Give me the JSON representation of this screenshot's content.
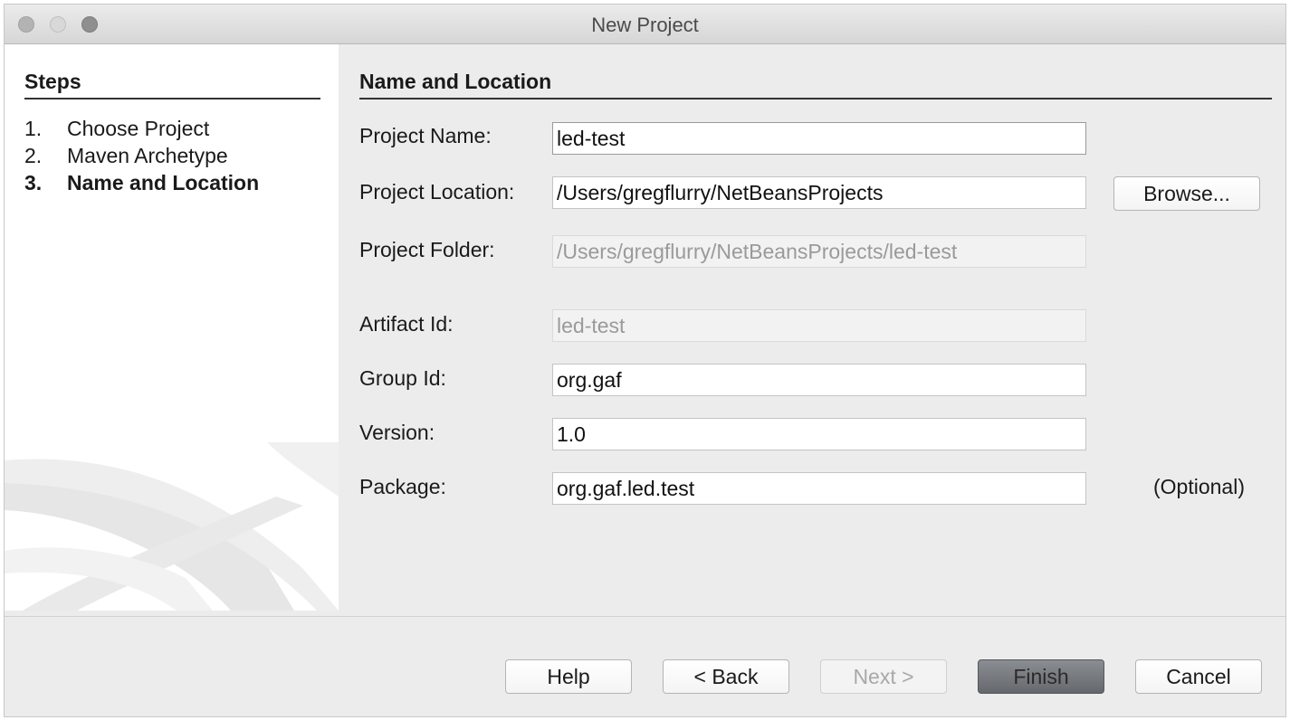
{
  "window": {
    "title": "New Project"
  },
  "steps": {
    "heading": "Steps",
    "items": [
      {
        "number": "1.",
        "label": "Choose Project"
      },
      {
        "number": "2.",
        "label": "Maven Archetype"
      },
      {
        "number": "3.",
        "label": "Name and Location"
      }
    ],
    "current_index": 2
  },
  "form": {
    "heading": "Name and Location",
    "project_name": {
      "label": "Project Name:",
      "value": "led-test"
    },
    "project_location": {
      "label": "Project Location:",
      "value": "/Users/gregflurry/NetBeansProjects"
    },
    "browse_label": "Browse...",
    "project_folder": {
      "label": "Project Folder:",
      "value": "/Users/gregflurry/NetBeansProjects/led-test"
    },
    "artifact_id": {
      "label": "Artifact Id:",
      "value": "led-test"
    },
    "group_id": {
      "label": "Group Id:",
      "value": "org.gaf"
    },
    "version": {
      "label": "Version:",
      "value": "1.0"
    },
    "package": {
      "label": "Package:",
      "value": "org.gaf.led.test",
      "note": "(Optional)"
    }
  },
  "footer": {
    "help_label": "Help",
    "back_label": "< Back",
    "next_label": "Next >",
    "finish_label": "Finish",
    "cancel_label": "Cancel"
  }
}
